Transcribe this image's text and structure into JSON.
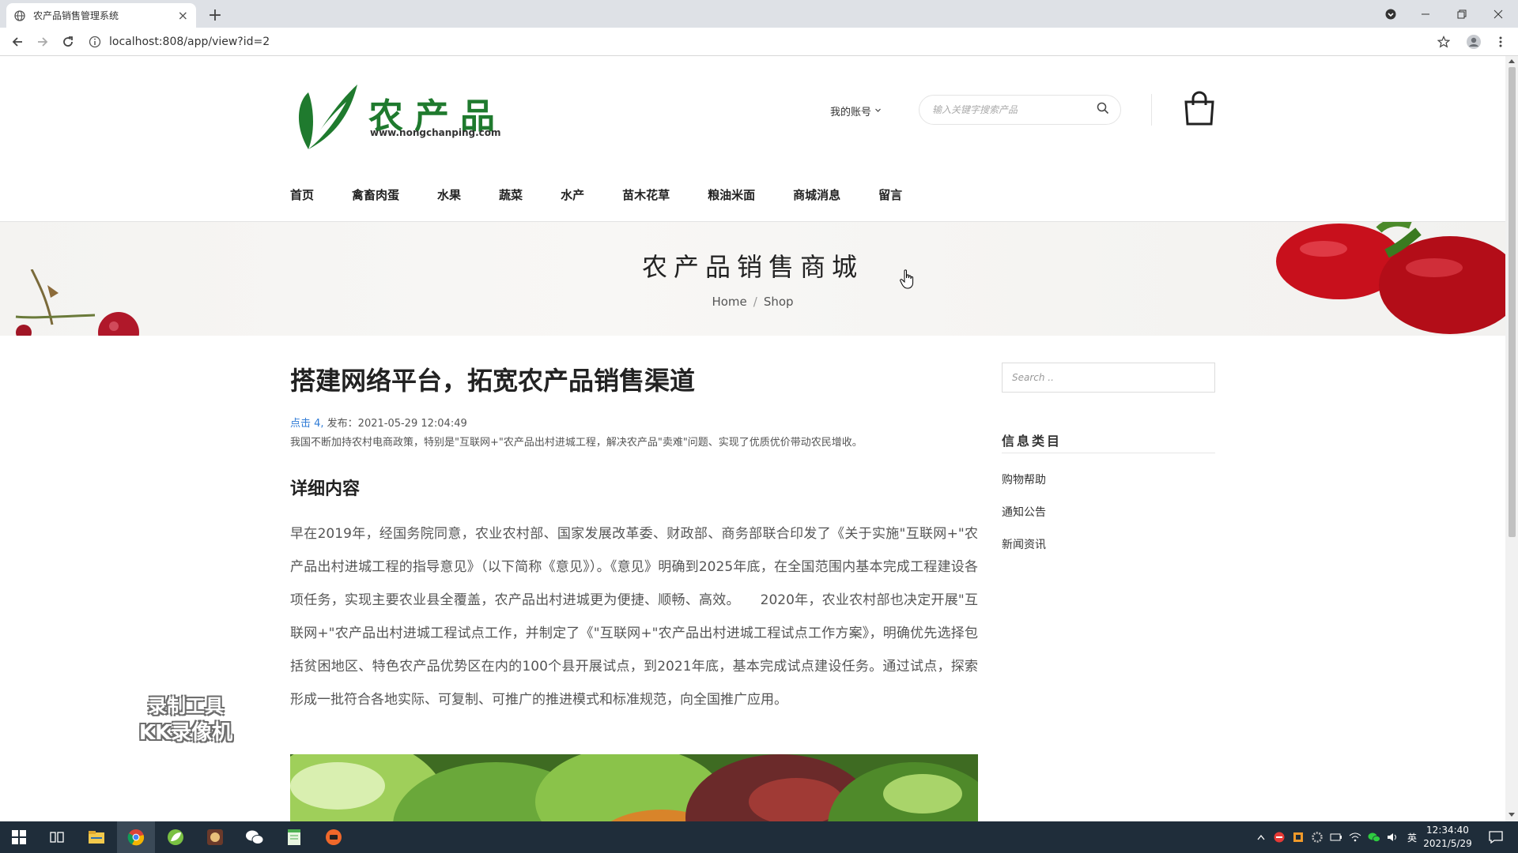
{
  "browser": {
    "tab_title": "农产品销售管理系统",
    "tab_close": "×",
    "new_tab": "+",
    "url": "localhost:808/app/view?id=2"
  },
  "site": {
    "logo_text": "农产品",
    "logo_url": "www.nongchanping.com",
    "account_label": "我的账号",
    "search_placeholder": "输入关键字搜索产品",
    "nav": [
      "首页",
      "禽畜肉蛋",
      "水果",
      "蔬菜",
      "水产",
      "苗木花草",
      "粮油米面",
      "商城消息",
      "留言"
    ]
  },
  "banner": {
    "title": "农产品销售商城",
    "crumb_home": "Home",
    "crumb_sep": "/",
    "crumb_current": "Shop"
  },
  "article": {
    "title": "搭建网络平台，拓宽农产品销售渠道",
    "clicks": "点击 4,",
    "published": " 发布：2021-05-29 12:04:49",
    "summary": "我国不断加持农村电商政策，特别是\"互联网+\"农产品出村进城工程，解决农产品\"卖难\"问题、实现了优质优价带动农民增收。",
    "section_heading": "详细内容",
    "body": "早在2019年，经国务院同意，农业农村部、国家发展改革委、财政部、商务部联合印发了《关于实施\"互联网+\"农产品出村进城工程的指导意见》（以下简称《意见》）。《意见》明确到2025年底，在全国范围内基本完成工程建设各项任务，实现主要农业县全覆盖，农产品出村进城更为便捷、顺畅、高效。　　2020年，农业农村部也决定开展\"互联网+\"农产品出村进城工程试点工作，并制定了《\"互联网+\"农产品出村进城工程试点工作方案》，明确优先选择包括贫困地区、特色农产品优势区在内的100个县开展试点，到2021年底，基本完成试点建设任务。通过试点，探索形成一批符合各地实际、可复制、可推广的推进模式和标准规范，向全国推广应用。"
  },
  "sidebar": {
    "search_placeholder": "Search ..",
    "category_heading": "信息类目",
    "categories": [
      "购物帮助",
      "通知公告",
      "新闻资讯"
    ]
  },
  "watermark": {
    "line1": "录制工具",
    "line2": "KK录像机"
  },
  "taskbar": {
    "time": "12:34:40",
    "date": "2021/5/29",
    "ime": "英"
  },
  "colors": {
    "brand_green": "#1f7a2e",
    "link_blue": "#2f7bd6",
    "taskbar": "#1f2d3a"
  }
}
